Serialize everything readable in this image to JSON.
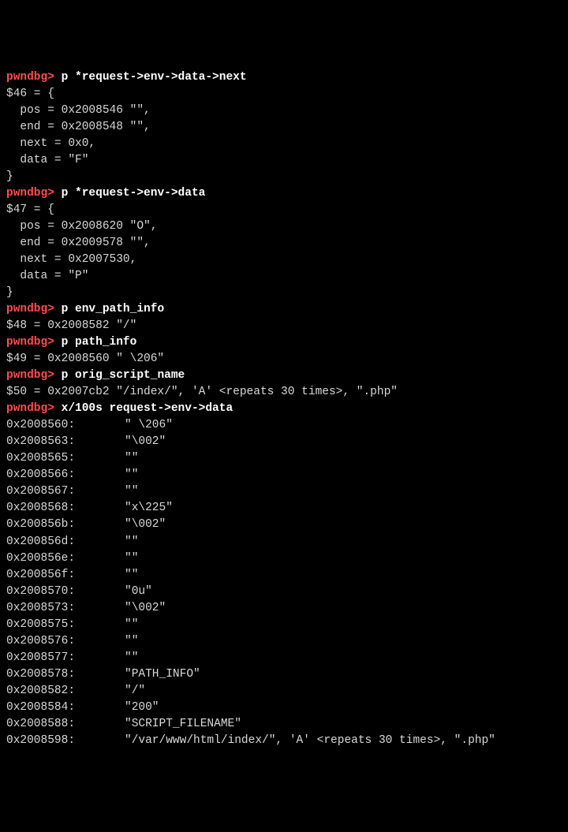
{
  "prompt": "pwndbg>",
  "commands": [
    {
      "cmd": "p *request->env->data->next",
      "output": [
        "$46 = {",
        "  pos = 0x2008546 \"\",",
        "  end = 0x2008548 \"\",",
        "  next = 0x0,",
        "  data = \"F\"",
        "}"
      ]
    },
    {
      "cmd": "p *request->env->data",
      "output": [
        "$47 = {",
        "  pos = 0x2008620 \"O\",",
        "  end = 0x2009578 \"\",",
        "  next = 0x2007530,",
        "  data = \"P\"",
        "}"
      ]
    },
    {
      "cmd": "p env_path_info",
      "output": [
        "$48 = 0x2008582 \"/\""
      ]
    },
    {
      "cmd": "p path_info",
      "output": [
        "$49 = 0x2008560 \" \\206\""
      ]
    },
    {
      "cmd": "p orig_script_name",
      "output": [
        "$50 = 0x2007cb2 \"/index/\", 'A' <repeats 30 times>, \".php\""
      ]
    }
  ],
  "memdump": {
    "cmd": "x/100s request->env->data",
    "rows": [
      {
        "addr": "0x2008560:",
        "val": "\" \\206\""
      },
      {
        "addr": "0x2008563:",
        "val": "\"\\002\""
      },
      {
        "addr": "0x2008565:",
        "val": "\"\""
      },
      {
        "addr": "0x2008566:",
        "val": "\"\""
      },
      {
        "addr": "0x2008567:",
        "val": "\"\""
      },
      {
        "addr": "0x2008568:",
        "val": "\"x\\225\""
      },
      {
        "addr": "0x200856b:",
        "val": "\"\\002\""
      },
      {
        "addr": "0x200856d:",
        "val": "\"\""
      },
      {
        "addr": "0x200856e:",
        "val": "\"\""
      },
      {
        "addr": "0x200856f:",
        "val": "\"\""
      },
      {
        "addr": "0x2008570:",
        "val": "\"0u\""
      },
      {
        "addr": "0x2008573:",
        "val": "\"\\002\""
      },
      {
        "addr": "0x2008575:",
        "val": "\"\""
      },
      {
        "addr": "0x2008576:",
        "val": "\"\""
      },
      {
        "addr": "0x2008577:",
        "val": "\"\""
      },
      {
        "addr": "0x2008578:",
        "val": "\"PATH_INFO\""
      },
      {
        "addr": "0x2008582:",
        "val": "\"/\""
      },
      {
        "addr": "0x2008584:",
        "val": "\"200\""
      },
      {
        "addr": "0x2008588:",
        "val": "\"SCRIPT_FILENAME\""
      },
      {
        "addr": "0x2008598:",
        "val": "\"/var/www/html/index/\", 'A' <repeats 30 times>, \".php\""
      }
    ]
  }
}
